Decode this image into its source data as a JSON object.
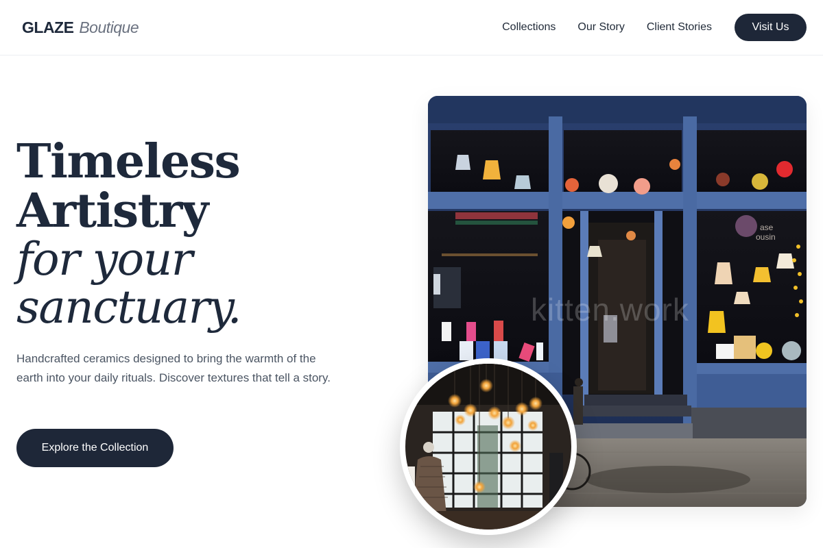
{
  "header": {
    "logo_main": "GLAZE",
    "logo_sub": "Boutique",
    "nav": [
      "Collections",
      "Our Story",
      "Client Stories"
    ],
    "visit_label": "Visit Us"
  },
  "hero": {
    "title_line1": "Timeless",
    "title_line2": "Artistry",
    "title_line3": "for your",
    "title_line4": "sanctuary.",
    "description": "Handcrafted ceramics designed to bring the warmth of the earth into your daily rituals. Discover textures that tell a story.",
    "cta_label": "Explore the Collection"
  },
  "images": {
    "main_alt": "Blue boutique storefront with hanging ceramic lamps",
    "circle_alt": "Interior with hanging Edison bulbs and a mannequin",
    "watermark": "kitten.work"
  },
  "colors": {
    "primary": "#1e2738",
    "text": "#1e293b",
    "muted": "#4b5563",
    "storefront_blue": "#4f6fa8"
  }
}
